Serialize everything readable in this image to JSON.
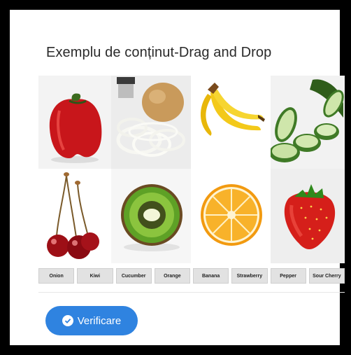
{
  "title": "Exemplu de conținut-Drag and Drop",
  "images": [
    {
      "name": "pepper-image"
    },
    {
      "name": "onion-image"
    },
    {
      "name": "banana-image"
    },
    {
      "name": "cucumber-image"
    },
    {
      "name": "sour-cherry-image"
    },
    {
      "name": "kiwi-image"
    },
    {
      "name": "orange-image"
    },
    {
      "name": "strawberry-image"
    }
  ],
  "labels": [
    "Onion",
    "Kiwi",
    "Cucumber",
    "Orange",
    "Banana",
    "Strawberry",
    "Pepper",
    "Sour Cherry"
  ],
  "verify_button": {
    "label": "Verificare",
    "icon": "check-circle-icon",
    "color": "#2f83e0"
  }
}
